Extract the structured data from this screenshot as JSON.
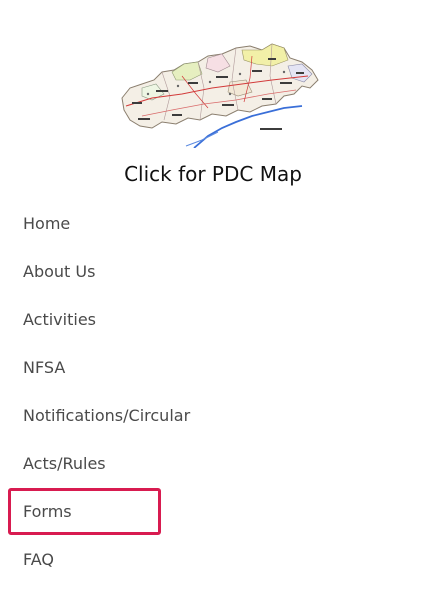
{
  "map": {
    "caption": "Click for PDC Map"
  },
  "nav": {
    "items": [
      {
        "label": "Home"
      },
      {
        "label": "About Us"
      },
      {
        "label": "Activities"
      },
      {
        "label": "NFSA"
      },
      {
        "label": "Notifications/Circular"
      },
      {
        "label": "Acts/Rules"
      },
      {
        "label": "Forms"
      },
      {
        "label": "FAQ"
      }
    ],
    "highlighted": "Forms"
  },
  "colors": {
    "highlight_border": "#d81b50",
    "nav_text": "#4a4a4a",
    "caption_text": "#111111"
  }
}
